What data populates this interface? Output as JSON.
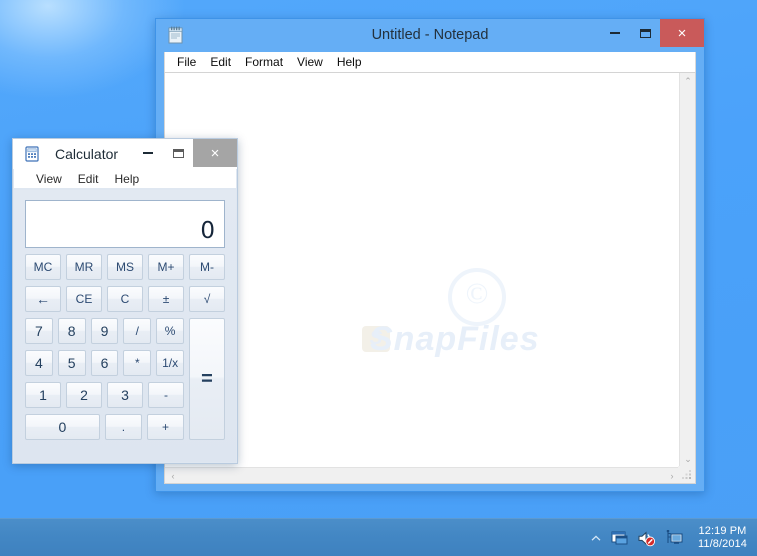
{
  "desktop": {
    "background_color": "#4ba2fa"
  },
  "taskbar": {
    "background_color": "#4387c4",
    "tray": {
      "chevron_icon": "show-hidden-icons-chevron",
      "icons": [
        {
          "name": "action-center-icon",
          "label": "Action Center"
        },
        {
          "name": "volume-muted-icon",
          "label": "Speakers: Muted"
        },
        {
          "name": "network-icon",
          "label": "Network"
        }
      ],
      "clock": {
        "time": "12:19 PM",
        "date": "11/8/2014"
      }
    }
  },
  "notepad": {
    "title": "Untitled - Notepad",
    "icon": "notepad-icon",
    "active": true,
    "titlebar_color": "#65aef5",
    "close_button_color": "#c95a5a",
    "controls": {
      "minimize": "Minimize",
      "maximize": "Maximize",
      "close": "×"
    },
    "menu": [
      "File",
      "Edit",
      "Format",
      "View",
      "Help"
    ],
    "text_value": "",
    "text_placeholder": "",
    "watermark": {
      "text": "SnapFiles",
      "badge": "S",
      "copyright": "©"
    },
    "scrollbars": {
      "vertical_up": "⌃",
      "vertical_down": "⌄",
      "horizontal_left": "‹",
      "horizontal_right": "›"
    }
  },
  "calculator": {
    "title": "Calculator",
    "icon": "calculator-icon",
    "active": false,
    "titlebar_color": "#ffffff",
    "close_button_color": "#a5a5a5",
    "controls": {
      "minimize": "Minimize",
      "maximize": "Maximize",
      "close": "×"
    },
    "menu": [
      "View",
      "Edit",
      "Help"
    ],
    "display": {
      "value": "0"
    },
    "memory_row": [
      "MC",
      "MR",
      "MS",
      "M+",
      "M-"
    ],
    "edit_row": [
      "←",
      "CE",
      "C",
      "±",
      "√"
    ],
    "keypad": [
      [
        "7",
        "8",
        "9",
        "/",
        "%"
      ],
      [
        "4",
        "5",
        "6",
        "*",
        "1/x"
      ],
      [
        "1",
        "2",
        "3",
        "-"
      ],
      [
        "0",
        ".",
        "+"
      ]
    ],
    "equals": "=",
    "accent_text_color": "#2c4a72"
  }
}
